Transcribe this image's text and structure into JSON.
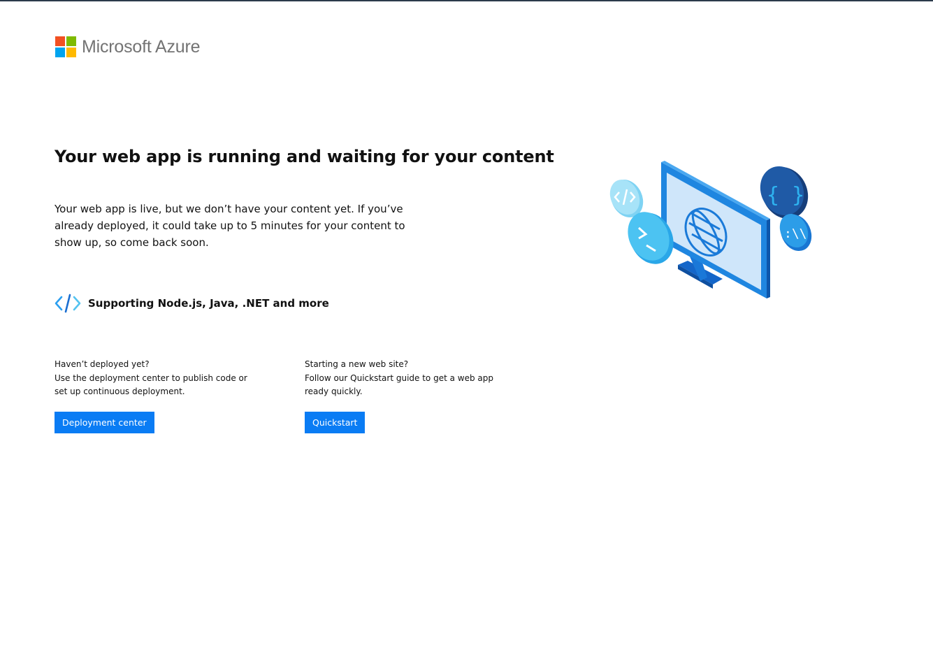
{
  "brand": {
    "name": "Microsoft Azure",
    "colors": {
      "red": "#f25022",
      "green": "#7fba00",
      "blue": "#00a4ef",
      "yellow": "#ffb900"
    }
  },
  "main": {
    "headline": "Your web app is running and waiting for your content",
    "intro": "Your web app is live, but we don’t have your content yet. If you’ve already deployed, it could take up to 5 minutes for your content to show up, so come back soon.",
    "support_icon": "code-brackets-icon",
    "support_text": "Supporting Node.js, Java, .NET and more"
  },
  "cards": {
    "deploy": {
      "question": "Haven’t deployed yet?",
      "description_line1": "Use the deployment center to publish code or",
      "description_line2": "set up continuous deployment.",
      "button_label": "Deployment center"
    },
    "quickstart": {
      "question": "Starting a new web site?",
      "description_line1": "Follow our Quickstart guide to get a web app",
      "description_line2": "ready quickly.",
      "button_label": "Quickstart"
    }
  },
  "illustration": {
    "icon": "monitor-globe-illustration",
    "accent": "#0a7cf4"
  }
}
